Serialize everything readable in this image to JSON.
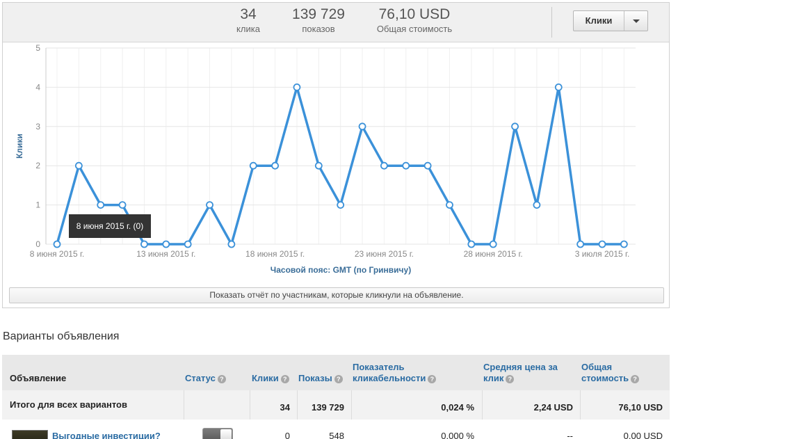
{
  "stats": {
    "clicks_value": "34",
    "clicks_label": "клика",
    "impressions_value": "139 729",
    "impressions_label": "показов",
    "cost_value": "76,10 USD",
    "cost_label": "Общая стоимость"
  },
  "metric_selector": {
    "label": "Клики",
    "icon": "caret-down-icon"
  },
  "chart_data": {
    "type": "line",
    "ylabel": "Клики",
    "xlabel": "Часовой пояс: GMT (по Гринвичу)",
    "ylim": [
      0,
      5
    ],
    "y_ticks": [
      "0",
      "1",
      "2",
      "3",
      "4",
      "5"
    ],
    "x_tick_labels": [
      "8 июня 2015 г.",
      "13 июня 2015 г.",
      "18 июня 2015 г.",
      "23 июня 2015 г.",
      "28 июня 2015 г.",
      "3 июля 2015 г."
    ],
    "x_tick_indices": [
      0,
      5,
      10,
      15,
      20,
      25
    ],
    "values": [
      0,
      2,
      1,
      1,
      0,
      0,
      0,
      1,
      0,
      2,
      2,
      4,
      2,
      1,
      3,
      2,
      2,
      2,
      1,
      0,
      0,
      3,
      1,
      4,
      0,
      0,
      0
    ],
    "grid": true,
    "color": "#3b91d9"
  },
  "tooltip": {
    "text": "8 июня 2015 г. (0)"
  },
  "report_link": "Показать отчёт по участникам, которые кликнули на объявление.",
  "section_title": "Варианты объявления",
  "table": {
    "headers": {
      "ad": "Объявление",
      "status": "Статус",
      "clicks": "Клики",
      "impressions": "Показы",
      "ctr_line1": "Показатель",
      "ctr_line2": "кликабельности",
      "avg_cpc_line1": "Средняя цена за",
      "avg_cpc_line2": "клик",
      "total_cost_line1": "Общая",
      "total_cost_line2": "стоимость"
    },
    "total_row": {
      "label": "Итого для всех вариантов",
      "clicks": "34",
      "impressions": "139 729",
      "ctr": "0,024 %",
      "avg_cpc": "2,24 USD",
      "total_cost": "76,10 USD"
    },
    "ad_row": {
      "title": "Выгодные инвестиции?",
      "clicks": "0",
      "impressions": "548",
      "ctr": "0,000 %",
      "avg_cpc": "--",
      "total_cost": "0,00 USD"
    }
  }
}
